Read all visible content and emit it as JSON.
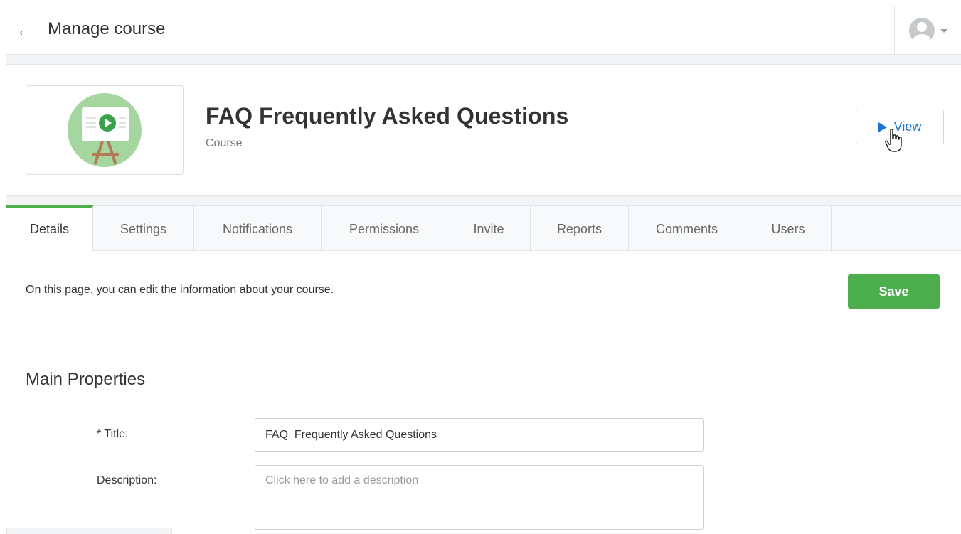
{
  "header": {
    "back_icon": "arrow-left-icon",
    "title": "Manage course",
    "user_icon": "user-avatar-icon"
  },
  "course": {
    "title": "FAQ Frequently Asked Questions",
    "type": "Course",
    "thumbnail_icon": "presentation-board-icon",
    "view_label": "View"
  },
  "tabs": [
    {
      "label": "Details",
      "active": true
    },
    {
      "label": "Settings"
    },
    {
      "label": "Notifications"
    },
    {
      "label": "Permissions"
    },
    {
      "label": "Invite"
    },
    {
      "label": "Reports"
    },
    {
      "label": "Comments"
    },
    {
      "label": "Users"
    }
  ],
  "details": {
    "info_text": "On this page, you can edit the information about your course.",
    "save_label": "Save",
    "section_title": "Main Properties",
    "title_label": "* Title:",
    "title_value": "FAQ  Frequently Asked Questions",
    "description_label": "Description:",
    "description_placeholder": "Click here to add a description"
  },
  "colors": {
    "accent_green": "#4cae4c",
    "link_blue": "#1976d2"
  }
}
